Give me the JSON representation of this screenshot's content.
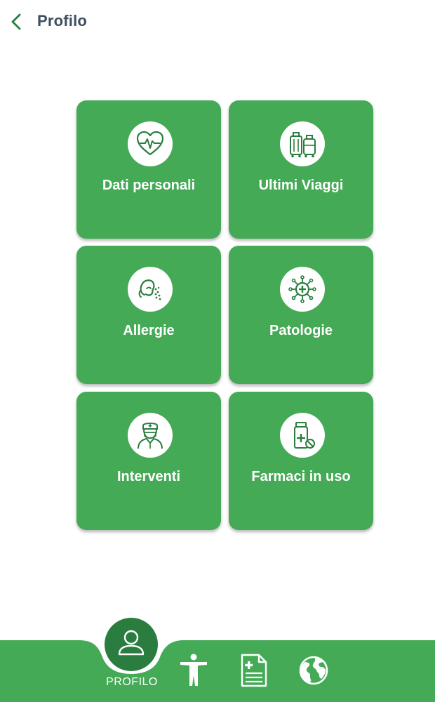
{
  "header": {
    "title": "Profilo",
    "back_icon": "chevron-left-icon"
  },
  "tiles": [
    {
      "label": "Dati personali",
      "icon": "heart-pulse-icon"
    },
    {
      "label": "Ultimi Viaggi",
      "icon": "luggage-icon"
    },
    {
      "label": "Allergie",
      "icon": "sneeze-allergy-icon"
    },
    {
      "label": "Patologie",
      "icon": "virus-icon"
    },
    {
      "label": "Interventi",
      "icon": "surgeon-icon"
    },
    {
      "label": "Farmaci in uso",
      "icon": "medicine-bottle-icon"
    }
  ],
  "bottom_nav": {
    "active_label": "PROFILO",
    "items": [
      {
        "name": "profile",
        "icon": "user-icon",
        "active": true
      },
      {
        "name": "body",
        "icon": "human-body-icon",
        "active": false
      },
      {
        "name": "document",
        "icon": "medical-document-icon",
        "active": false
      },
      {
        "name": "world",
        "icon": "globe-icon",
        "active": false
      }
    ]
  },
  "colors": {
    "primary_green": "#44aa56",
    "dark_green": "#2a7d3f",
    "title_text": "#3f4f5f",
    "white": "#ffffff"
  }
}
